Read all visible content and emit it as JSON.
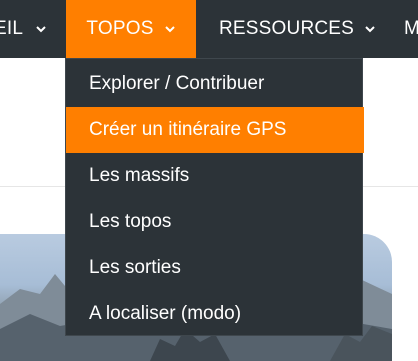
{
  "navbar": {
    "items": [
      {
        "label": "EIL",
        "icon": "chevron-down-icon"
      },
      {
        "label": "TOPOS",
        "icon": "chevron-down-icon",
        "active": true
      },
      {
        "label": "RESSOURCES",
        "icon": "chevron-down-icon"
      },
      {
        "label": "M"
      }
    ]
  },
  "dropdown": {
    "items": [
      {
        "label": "Explorer / Contribuer"
      },
      {
        "label": "Créer un itinéraire GPS",
        "highlighted": true
      },
      {
        "label": "Les massifs"
      },
      {
        "label": "Les topos"
      },
      {
        "label": "Les sorties"
      },
      {
        "label": "A localiser (modo)"
      }
    ]
  },
  "colors": {
    "navbar_bg": "#2c3338",
    "accent": "#ff7f00",
    "text": "#ffffff"
  }
}
